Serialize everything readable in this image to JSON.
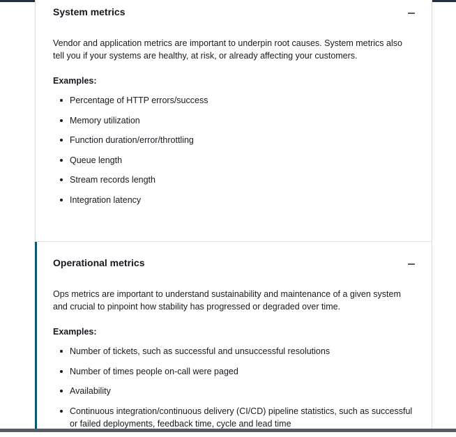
{
  "sections": [
    {
      "title": "System metrics",
      "description": "Vendor and application metrics are important to underpin root causes. System metrics also tell you if your systems are healthy, at risk, or already affecting your customers.",
      "examples_label": "Examples:",
      "examples": [
        "Percentage of HTTP errors/success",
        "Memory utilization",
        "Function duration/error/throttling",
        "Queue length",
        "Stream records length",
        "Integration latency"
      ],
      "collapse_icon": "minus-icon"
    },
    {
      "title": "Operational metrics",
      "description": "Ops metrics are important to understand sustainability and maintenance of a given system and crucial to pinpoint how stability has progressed or degraded over time.",
      "examples_label": "Examples:",
      "examples": [
        "Number of tickets, such as successful and unsuccessful resolutions",
        "Number of times people on-call were paged",
        "Availability",
        "Continuous integration/continuous delivery (CI/CD) pipeline statistics, such as successful or failed deployments, feedback time, cycle and lead time"
      ],
      "collapse_icon": "minus-icon"
    }
  ],
  "colors": {
    "text": "#16191f",
    "panel_border": "#d5dbdb",
    "active_accent": "#0b5577",
    "top_bar": "#232f3e",
    "bottom_bar": "#545b64"
  }
}
